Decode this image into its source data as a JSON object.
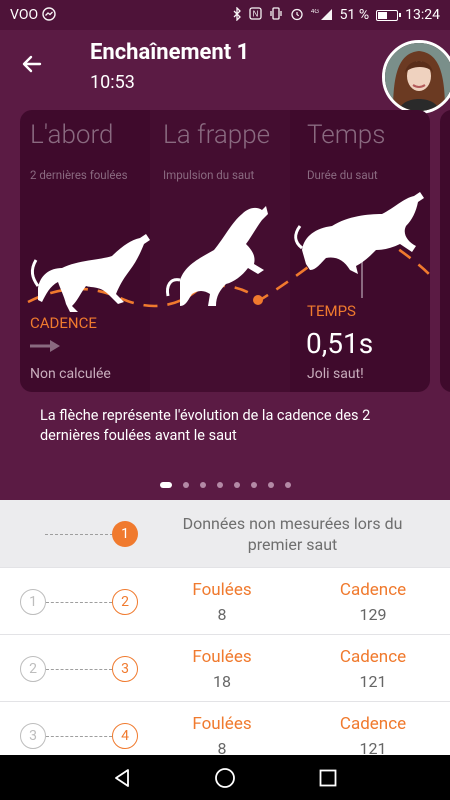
{
  "status_bar": {
    "carrier": "VOO",
    "battery_text": "51 %",
    "time": "13:24",
    "battery_level": 0.51,
    "icons": [
      "messenger-icon",
      "bluetooth-icon",
      "nfc-icon",
      "vibrate-icon",
      "alarm-icon",
      "signal-4g-icon",
      "battery-icon"
    ]
  },
  "header": {
    "title": "Enchaînement 1",
    "time": "10:53"
  },
  "card": {
    "columns": [
      {
        "title": "L'abord",
        "subtitle": "2 dernières foulées"
      },
      {
        "title": "La frappe",
        "subtitle": "Impulsion du saut"
      },
      {
        "title": "Temps",
        "subtitle": "Durée du saut"
      }
    ],
    "cadence_label": "CADENCE",
    "cadence_status": "Non calculée",
    "temps_label": "TEMPS",
    "temps_value": "0,51s",
    "temps_comment": "Joli saut!"
  },
  "caption": "La flèche représente l'évolution de la cadence des 2 dernières foulées avant le saut",
  "pager": {
    "count": 8,
    "active_index": 0
  },
  "list": {
    "first_row": {
      "index": "1",
      "text": "Données non mesurées lors du premier saut"
    },
    "rows": [
      {
        "from": "1",
        "to": "2",
        "foulees_label": "Foulées",
        "foulees_value": "8",
        "cadence_label": "Cadence",
        "cadence_value": "129"
      },
      {
        "from": "2",
        "to": "3",
        "foulees_label": "Foulées",
        "foulees_value": "18",
        "cadence_label": "Cadence",
        "cadence_value": "121"
      },
      {
        "from": "3",
        "to": "4",
        "foulees_label": "Foulées",
        "foulees_value": "8",
        "cadence_label": "Cadence",
        "cadence_value": "121"
      }
    ]
  },
  "colors": {
    "primary": "#5b1b44",
    "card": "#3f0a2c",
    "accent": "#f07a2e"
  }
}
